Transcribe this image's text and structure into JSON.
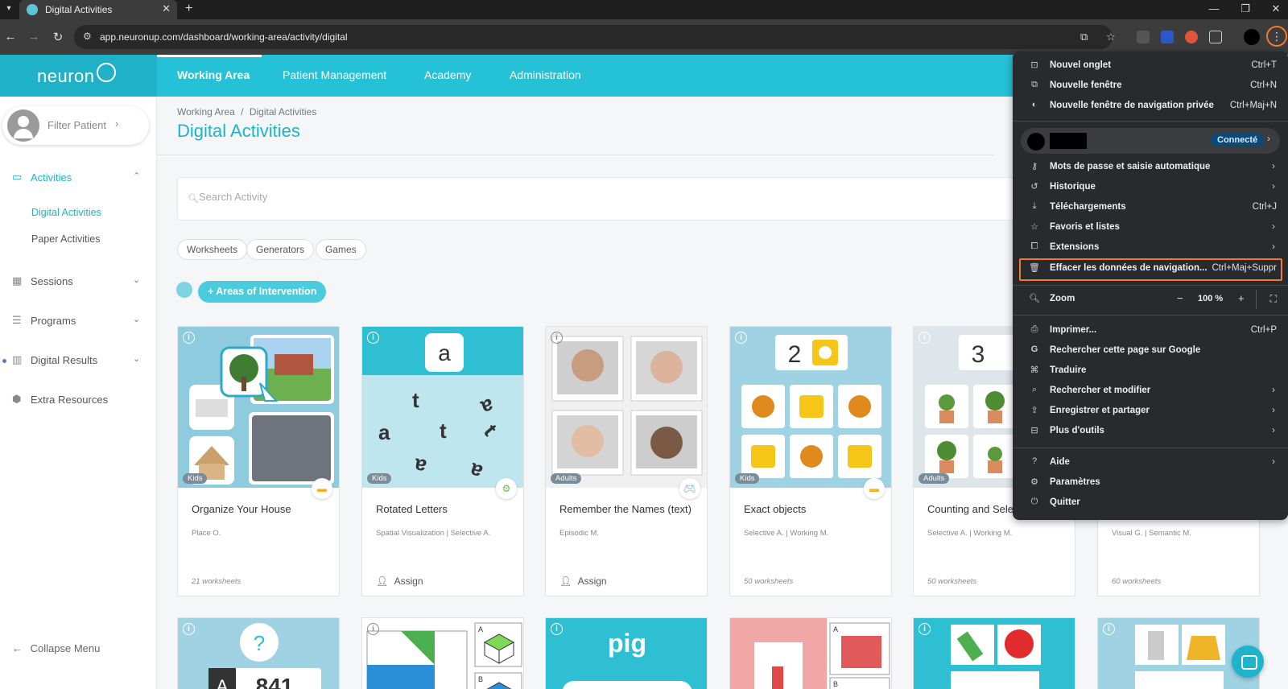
{
  "browser": {
    "tab_title": "Digital Activities",
    "url": "app.neuronup.com/dashboard/working-area/activity/digital",
    "new_tab_symbol": "+",
    "close_symbol": "✕"
  },
  "app": {
    "logo": "neuron",
    "nav": [
      "Working Area",
      "Patient Management",
      "Academy",
      "Administration"
    ]
  },
  "sidebar": {
    "filter_patient": "Filter Patient",
    "activities": "Activities",
    "digital_activities": "Digital Activities",
    "paper_activities": "Paper Activities",
    "sessions": "Sessions",
    "programs": "Programs",
    "digital_results": "Digital Results",
    "extra_resources": "Extra Resources",
    "collapse": "Collapse Menu"
  },
  "main": {
    "breadcrumb_root": "Working Area",
    "breadcrumb_sep": "/",
    "breadcrumb_current": "Digital Activities",
    "title": "Digital Activities",
    "search_placeholder": "Search Activity",
    "chips": [
      "Worksheets",
      "Generators",
      "Games"
    ],
    "areas_button": "+ Areas of Intervention"
  },
  "cards": [
    {
      "title": "Organize Your House",
      "badge": "Kids",
      "subtitle": "Place O.",
      "footer": "21 worksheets",
      "assign": ""
    },
    {
      "title": "Rotated Letters",
      "badge": "Kids",
      "subtitle": "Spatial Visualization | Selective A.",
      "footer": "",
      "assign": "Assign"
    },
    {
      "title": "Remember the Names (text)",
      "badge": "Adults",
      "subtitle": "Episodic M.",
      "footer": "",
      "assign": "Assign"
    },
    {
      "title": "Exact objects",
      "badge": "Kids",
      "subtitle": "Selective A. | Working M.",
      "footer": "50 worksheets",
      "assign": ""
    },
    {
      "title": "Counting and Selec",
      "badge": "Adults",
      "subtitle": "Selective A. | Working M.",
      "footer": "50 worksheets",
      "assign": ""
    },
    {
      "title": "",
      "badge": "",
      "subtitle": "Visual G. | Semantic M.",
      "footer": "60 worksheets",
      "assign": ""
    }
  ],
  "card_images": {
    "letter_a": "a",
    "exact_count": "2",
    "counting_count": "3",
    "pig": "pig",
    "number": "841",
    "letter_A": "A",
    "letter_B": "B"
  },
  "chrome_menu": {
    "new_tab": "Nouvel onglet",
    "new_tab_sc": "Ctrl+T",
    "new_window": "Nouvelle fenêtre",
    "new_window_sc": "Ctrl+N",
    "incognito": "Nouvelle fenêtre de navigation privée",
    "incognito_sc": "Ctrl+Maj+N",
    "connected": "Connecté",
    "passwords": "Mots de passe et saisie automatique",
    "history": "Historique",
    "downloads": "Téléchargements",
    "downloads_sc": "Ctrl+J",
    "bookmarks": "Favoris et listes",
    "extensions": "Extensions",
    "clear_data": "Effacer les données de navigation...",
    "clear_data_sc": "Ctrl+Maj+Suppr",
    "zoom": "Zoom",
    "zoom_value": "100 %",
    "print": "Imprimer...",
    "print_sc": "Ctrl+P",
    "search_google": "Rechercher cette page sur Google",
    "translate": "Traduire",
    "find_edit": "Rechercher et modifier",
    "save_share": "Enregistrer et partager",
    "more_tools": "Plus d'outils",
    "help": "Aide",
    "settings": "Paramètres",
    "quit": "Quitter"
  },
  "colors": {
    "brand": "#25c1d7",
    "accent_highlight": "#f07c2a",
    "menu_bg": "#292a2d"
  },
  "icons": {
    "back": "back-arrow-icon",
    "forward": "forward-arrow-icon",
    "reload": "reload-icon",
    "bookmark": "star-icon",
    "menu": "three-dots-icon",
    "chat": "chat-icon"
  }
}
